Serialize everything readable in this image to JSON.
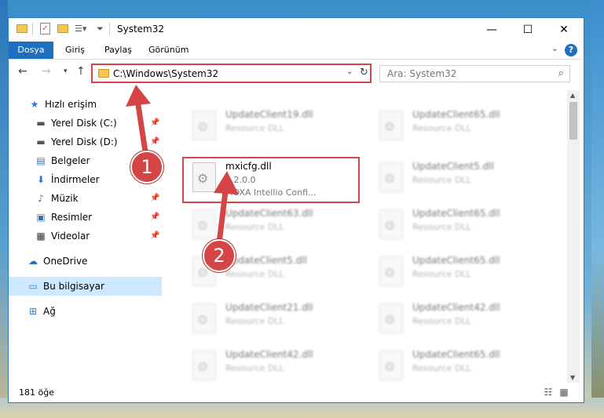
{
  "window": {
    "title": "System32",
    "controls": {
      "minimize": "—",
      "maximize": "☐",
      "close": "✕"
    }
  },
  "ribbon": {
    "tabs": [
      "Dosya",
      "Giriş",
      "Paylaş",
      "Görünüm"
    ],
    "help": "?"
  },
  "address": {
    "path": "C:\\Windows\\System32",
    "search_placeholder": "Ara: System32"
  },
  "navigation": {
    "items": [
      {
        "label": "Hızlı erişim",
        "icon": "star-icon",
        "glyph": "★",
        "color": "#2b7bd6",
        "pinned": false
      },
      {
        "label": "Yerel Disk (C:)",
        "icon": "drive-icon",
        "glyph": "▬",
        "color": "#555555",
        "pinned": true
      },
      {
        "label": "Yerel Disk (D:)",
        "icon": "drive-icon",
        "glyph": "▬",
        "color": "#555555",
        "pinned": true
      },
      {
        "label": "Belgeler",
        "icon": "documents-icon",
        "glyph": "▤",
        "color": "#3a6fb0",
        "pinned": true
      },
      {
        "label": "İndirmeler",
        "icon": "download-icon",
        "glyph": "⬇",
        "color": "#2b7bd6",
        "pinned": true
      },
      {
        "label": "Müzik",
        "icon": "music-icon",
        "glyph": "♪",
        "color": "#2b7bd6",
        "pinned": true
      },
      {
        "label": "Resimler",
        "icon": "pictures-icon",
        "glyph": "▣",
        "color": "#3a6fb0",
        "pinned": true
      },
      {
        "label": "Videolar",
        "icon": "video-icon",
        "glyph": "▦",
        "color": "#333333",
        "pinned": true
      },
      {
        "label": "OneDrive",
        "icon": "cloud-icon",
        "glyph": "☁",
        "color": "#1f6fbf",
        "pinned": false
      },
      {
        "label": "Bu bilgisayar",
        "icon": "computer-icon",
        "glyph": "▭",
        "color": "#2b7bd6",
        "pinned": false,
        "selected": true
      },
      {
        "label": "Ağ",
        "icon": "network-icon",
        "glyph": "⊞",
        "color": "#2b7bd6",
        "pinned": false
      }
    ],
    "pin_glyph": "📌"
  },
  "files": {
    "left_column": [
      {
        "name": "UpdateClient19.dll",
        "type": "Resource DLL",
        "blurred": true
      },
      {
        "name": "mxicfg.dll",
        "version": "1.2.0.0",
        "desc": "MOXA Intellio Confi...",
        "blurred": false,
        "highlighted": true
      },
      {
        "name": "UpdateClient63.dll",
        "type": "Resource DLL",
        "blurred": true
      },
      {
        "name": "UpdateClient5.dll",
        "type": "Resource DLL",
        "blurred": true
      },
      {
        "name": "UpdateClient21.dll",
        "type": "Resource DLL",
        "blurred": true
      },
      {
        "name": "UpdateClient42.dll",
        "type": "Resource DLL",
        "blurred": true
      }
    ],
    "right_column": [
      {
        "name": "UpdateClient65.dll",
        "type": "Resource DLL"
      },
      {
        "name": "UpdateClient5.dll",
        "type": "Resource DLL"
      },
      {
        "name": "UpdateClient65.dll",
        "type": "Resource DLL"
      },
      {
        "name": "UpdateClient65.dll",
        "type": "Resource DLL"
      },
      {
        "name": "UpdateClient42.dll",
        "type": "Resource DLL"
      },
      {
        "name": "UpdateClient65.dll",
        "type": "Resource DLL"
      }
    ]
  },
  "status": {
    "count": "181 öğe"
  },
  "annotations": {
    "step1": "1",
    "step2": "2",
    "color": "#d64545"
  }
}
